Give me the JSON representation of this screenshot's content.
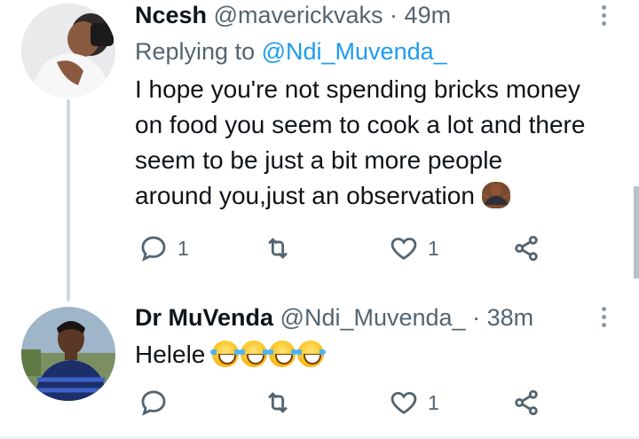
{
  "tweets": [
    {
      "name": "Ncesh",
      "handle": "@maverickvaks",
      "separator": "·",
      "time": "49m",
      "replying_prefix": "Replying to",
      "replying_to": "@Ndi_Muvenda_",
      "text": "I hope you're not spending bricks money on food you seem to cook a lot and there seem to be just a bit more people around you,just an observation",
      "emoji": [
        "man-shrugging-emoji"
      ],
      "reply_count": "1",
      "retweet_count": "",
      "like_count": "1"
    },
    {
      "name": "Dr MuVenda",
      "handle": "@Ndi_Muvenda_",
      "separator": "·",
      "time": "38m",
      "text": "Helele",
      "emoji": [
        "tears-of-joy-emoji",
        "tears-of-joy-emoji",
        "tears-of-joy-emoji",
        "tears-of-joy-emoji"
      ],
      "reply_count": "",
      "retweet_count": "",
      "like_count": "1"
    }
  ],
  "icons": {
    "reply": "reply-icon",
    "retweet": "retweet-icon",
    "like": "heart-icon",
    "share": "share-icon",
    "more": "more-vertical-icon"
  },
  "colors": {
    "link": "#1d9bf0",
    "secondary_text": "#536471",
    "thread_line": "#cfd9de"
  }
}
